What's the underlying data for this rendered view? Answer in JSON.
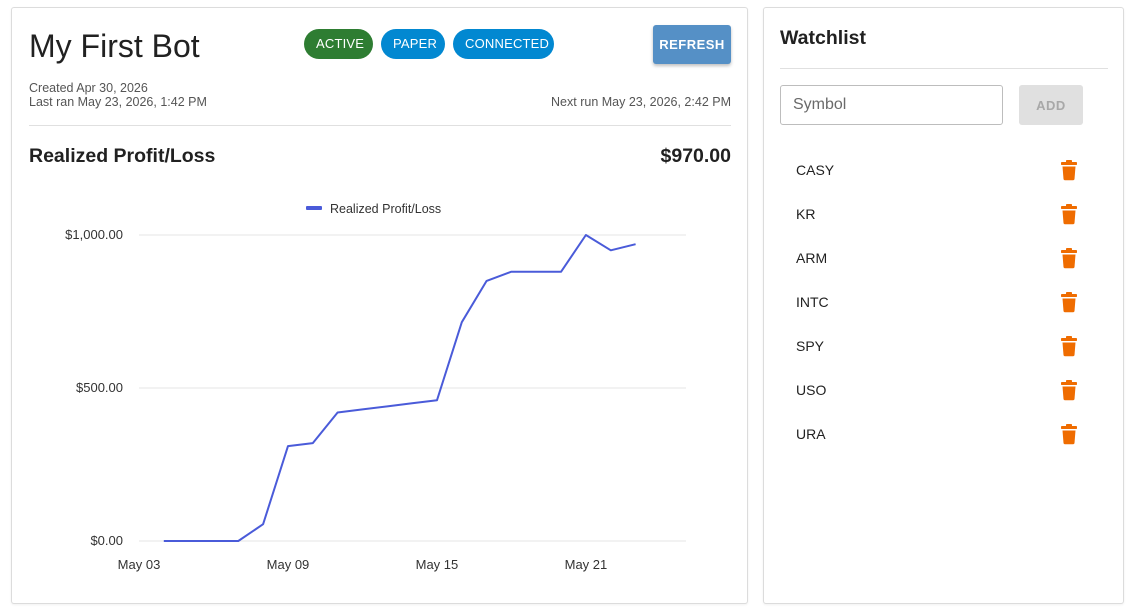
{
  "bot": {
    "title": "My First Bot",
    "chips": [
      {
        "label": "ACTIVE",
        "color": "#2e7d32"
      },
      {
        "label": "PAPER",
        "color": "#0288d1"
      },
      {
        "label": "CONNECTED",
        "color": "#0288d1"
      }
    ],
    "refresh_label": "REFRESH",
    "refresh_color": "#5590c6",
    "created": "Created Apr 30, 2026",
    "last_ran": "Last ran May 23, 2026, 1:42 PM",
    "next_run": "Next run May 23, 2026, 2:42 PM",
    "section_title": "Realized Profit/Loss",
    "section_value": "$970.00"
  },
  "chart_data": {
    "type": "line",
    "legend": "Realized Profit/Loss",
    "series_color": "#4a5bd9",
    "x": [
      "2026-05-04",
      "2026-05-05",
      "2026-05-06",
      "2026-05-07",
      "2026-05-08",
      "2026-05-09",
      "2026-05-10",
      "2026-05-11",
      "2026-05-12",
      "2026-05-13",
      "2026-05-14",
      "2026-05-15",
      "2026-05-16",
      "2026-05-17",
      "2026-05-18",
      "2026-05-19",
      "2026-05-20",
      "2026-05-21",
      "2026-05-22",
      "2026-05-23"
    ],
    "values": [
      0,
      0,
      0,
      0,
      55,
      310,
      320,
      420,
      430,
      440,
      450,
      460,
      715,
      850,
      880,
      880,
      880,
      1000,
      950,
      970
    ],
    "x_ticks": [
      "May 03",
      "May 09",
      "May 15",
      "May 21"
    ],
    "x_tick_dates": [
      "2026-05-03",
      "2026-05-09",
      "2026-05-15",
      "2026-05-21"
    ],
    "y_ticks": [
      "$0.00",
      "$500.00",
      "$1,000.00"
    ],
    "y_tick_values": [
      0,
      500,
      1000
    ],
    "ylim": [
      0,
      1000
    ],
    "grid": true,
    "legend_position": "top-center"
  },
  "watchlist": {
    "title": "Watchlist",
    "input_placeholder": "Symbol",
    "add_label": "ADD",
    "delete_icon_color": "#ef6c00",
    "symbols": [
      "CASY",
      "KR",
      "ARM",
      "INTC",
      "SPY",
      "USO",
      "URA"
    ]
  }
}
